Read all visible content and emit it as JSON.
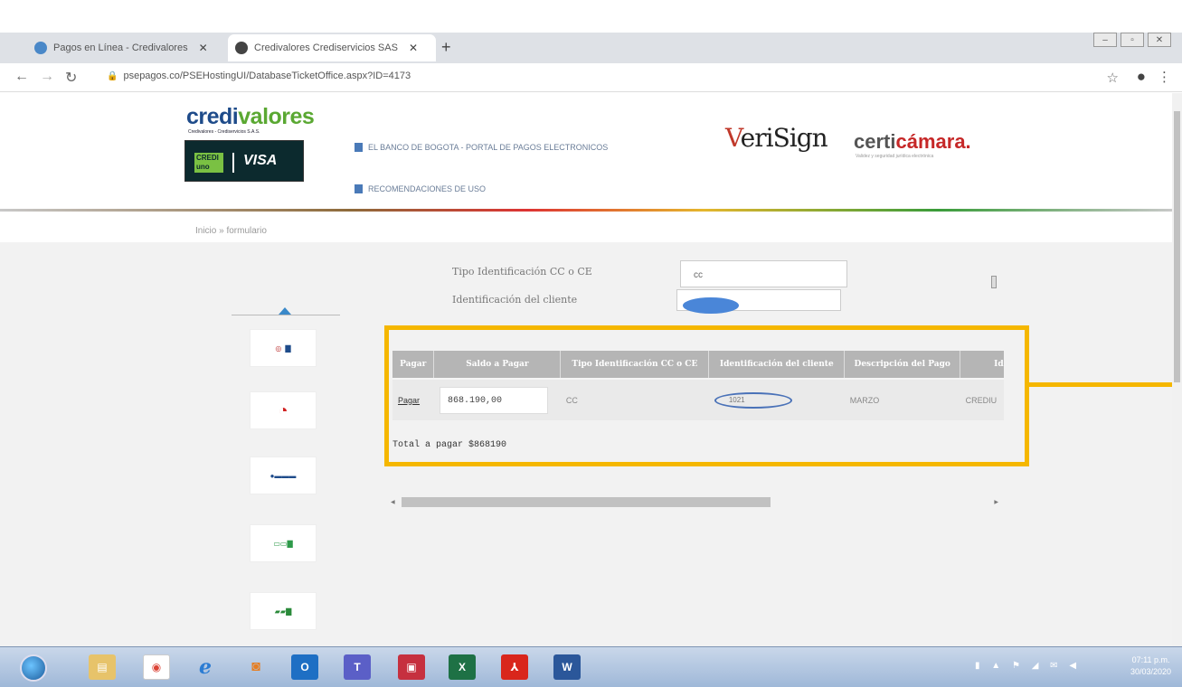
{
  "browser": {
    "tabs": [
      {
        "title": "Pagos en Línea - Credivalores",
        "active": false
      },
      {
        "title": "Credivalores Crediservicios SAS",
        "active": true
      }
    ],
    "url": "psepagos.co/PSEHostingUI/DatabaseTicketOffice.aspx?ID=4173"
  },
  "header": {
    "brand_a": "credi",
    "brand_b": "valores",
    "brand_tag": "Credivalores - Crediservicios S.A.S.",
    "card_crediuno": "CREDI uno",
    "card_visa": "VISA",
    "link_portal": "EL BANCO DE BOGOTA - PORTAL DE PAGOS ELECTRONICOS",
    "link_recomendaciones": "RECOMENDACIONES DE USO",
    "verisign": "eriSign",
    "verisign_v": "V",
    "certicamara_a": "certi",
    "certicamara_b": "cámara.",
    "certicamara_sub": "Validez y seguridad jurídica electrónica"
  },
  "breadcrumb": "Inicio » formulario",
  "form": {
    "tipo_label": "Tipo Identificación CC o CE",
    "tipo_value": "cc",
    "ident_label": "Identificación del cliente"
  },
  "table": {
    "headers": [
      "Pagar",
      "Saldo a Pagar",
      "Tipo Identificación CC o CE",
      "Identificación del cliente",
      "Descripción del Pago",
      "Identifi"
    ],
    "row": {
      "pagar": "Pagar",
      "saldo": "868.190,00",
      "tipo": "CC",
      "ident": "1021",
      "descripcion": "MARZO",
      "identifi": "CREDIU"
    },
    "total": "Total a pagar  $868190"
  },
  "taskbar": {
    "time": "07:11 p.m.",
    "date": "30/03/2020"
  },
  "colors": {
    "highlight": "#f5b700",
    "table_header": "#b5b5b5"
  }
}
